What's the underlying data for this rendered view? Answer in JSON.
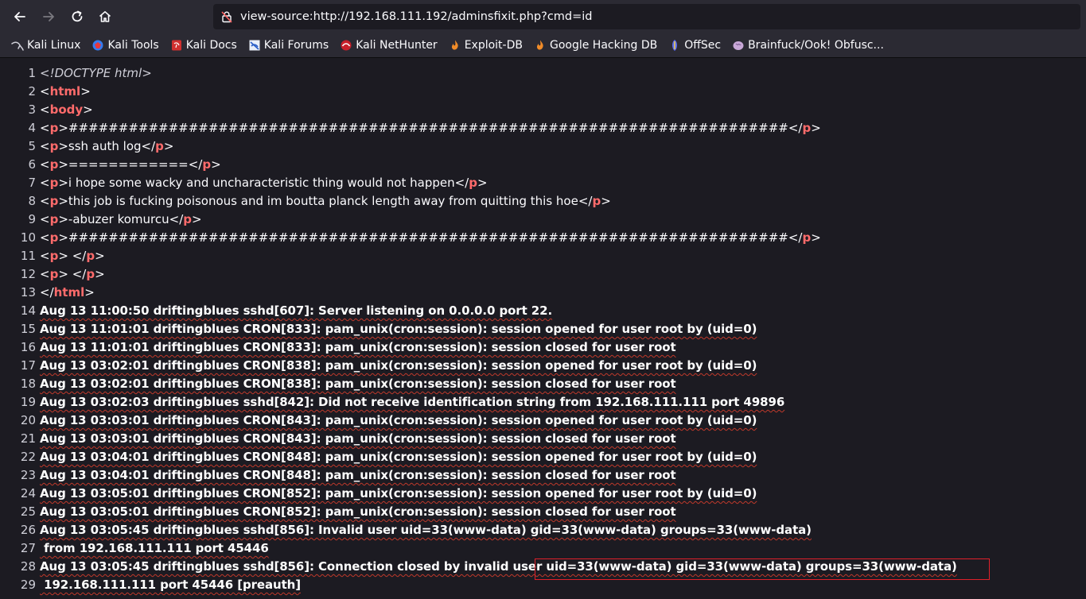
{
  "browser": {
    "url": "view-source:http://192.168.111.192/adminsfixit.php?cmd=id",
    "bookmarks": [
      {
        "label": "Kali Linux",
        "icon": "kali-linux-icon"
      },
      {
        "label": "Kali Tools",
        "icon": "kali-tools-icon"
      },
      {
        "label": "Kali Docs",
        "icon": "kali-docs-icon"
      },
      {
        "label": "Kali Forums",
        "icon": "kali-forums-icon"
      },
      {
        "label": "Kali NetHunter",
        "icon": "kali-nethunter-icon"
      },
      {
        "label": "Exploit-DB",
        "icon": "exploit-db-icon"
      },
      {
        "label": "Google Hacking DB",
        "icon": "google-hacking-db-icon"
      },
      {
        "label": "OffSec",
        "icon": "offsec-icon"
      },
      {
        "label": "Brainfuck/Ook! Obfusc...",
        "icon": "brainfuck-icon"
      }
    ]
  },
  "source_lines": [
    {
      "n": "1",
      "type": "doctype",
      "text": "<!DOCTYPE html>"
    },
    {
      "n": "2",
      "type": "tag",
      "tag": "html",
      "open": true
    },
    {
      "n": "3",
      "type": "tag",
      "tag": "body",
      "open": true
    },
    {
      "n": "4",
      "type": "p",
      "text": "########################################################################"
    },
    {
      "n": "5",
      "type": "p",
      "text": "ssh auth log"
    },
    {
      "n": "6",
      "type": "p",
      "text": "============"
    },
    {
      "n": "7",
      "type": "p",
      "text": "i hope some wacky and uncharacteristic thing would not happen"
    },
    {
      "n": "8",
      "type": "p",
      "text": "this job is fucking poisonous and im boutta planck length away from quitting this hoe"
    },
    {
      "n": "9",
      "type": "p",
      "text": "-abuzer komurcu"
    },
    {
      "n": "10",
      "type": "p",
      "text": "########################################################################"
    },
    {
      "n": "11",
      "type": "p",
      "text": " "
    },
    {
      "n": "12",
      "type": "p",
      "text": " "
    },
    {
      "n": "13",
      "type": "tag",
      "tag": "html",
      "open": false
    },
    {
      "n": "14",
      "type": "log",
      "text": "Aug 13 11:00:50 driftingblues sshd[607]: Server listening on 0.0.0.0 port 22."
    },
    {
      "n": "15",
      "type": "log",
      "text": "Aug 13 11:01:01 driftingblues CRON[833]: pam_unix(cron:session): session opened for user root by (uid=0)"
    },
    {
      "n": "16",
      "type": "log",
      "text": "Aug 13 11:01:01 driftingblues CRON[833]: pam_unix(cron:session): session closed for user root"
    },
    {
      "n": "17",
      "type": "log",
      "text": "Aug 13 03:02:01 driftingblues CRON[838]: pam_unix(cron:session): session opened for user root by (uid=0)"
    },
    {
      "n": "18",
      "type": "log",
      "text": "Aug 13 03:02:01 driftingblues CRON[838]: pam_unix(cron:session): session closed for user root"
    },
    {
      "n": "19",
      "type": "log",
      "text": "Aug 13 03:02:03 driftingblues sshd[842]: Did not receive identification string from 192.168.111.111 port 49896"
    },
    {
      "n": "20",
      "type": "log",
      "text": "Aug 13 03:03:01 driftingblues CRON[843]: pam_unix(cron:session): session opened for user root by (uid=0)"
    },
    {
      "n": "21",
      "type": "log",
      "text": "Aug 13 03:03:01 driftingblues CRON[843]: pam_unix(cron:session): session closed for user root"
    },
    {
      "n": "22",
      "type": "log",
      "text": "Aug 13 03:04:01 driftingblues CRON[848]: pam_unix(cron:session): session opened for user root by (uid=0)"
    },
    {
      "n": "23",
      "type": "log",
      "text": "Aug 13 03:04:01 driftingblues CRON[848]: pam_unix(cron:session): session closed for user root"
    },
    {
      "n": "24",
      "type": "log",
      "text": "Aug 13 03:05:01 driftingblues CRON[852]: pam_unix(cron:session): session opened for user root by (uid=0)"
    },
    {
      "n": "25",
      "type": "log",
      "text": "Aug 13 03:05:01 driftingblues CRON[852]: pam_unix(cron:session): session closed for user root"
    },
    {
      "n": "26",
      "type": "log",
      "text": "Aug 13 03:05:45 driftingblues sshd[856]: Invalid user uid=33(www-data) gid=33(www-data) groups=33(www-data)"
    },
    {
      "n": "27",
      "type": "log",
      "text": " from 192.168.111.111 port 45446"
    },
    {
      "n": "28",
      "type": "log",
      "text": "Aug 13 03:05:45 driftingblues sshd[856]: Connection closed by invalid user uid=33(www-data) gid=33(www-data) groups=33(www-data)"
    },
    {
      "n": "29",
      "type": "log",
      "text": " 192.168.111.111 port 45446 [preauth]"
    }
  ],
  "colors": {
    "tag": "#ff5f5f",
    "highlight_box": "#e0202a",
    "background": "#1c1b22"
  }
}
